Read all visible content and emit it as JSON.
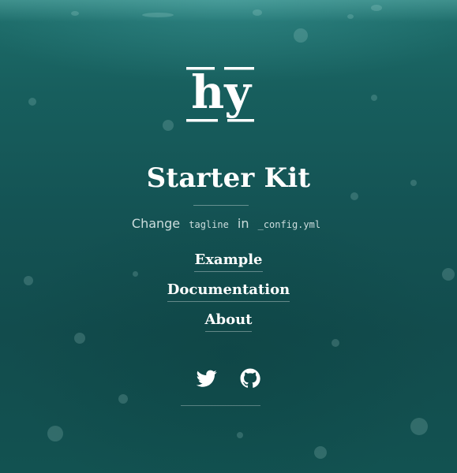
{
  "logo": {
    "alt": "hy"
  },
  "site": {
    "title": "Starter Kit",
    "tagline": {
      "prefix": "Change",
      "code1": "tagline",
      "middle": "in",
      "code2": "_config.yml"
    }
  },
  "nav": {
    "items": [
      {
        "label": "Example"
      },
      {
        "label": "Documentation"
      },
      {
        "label": "About"
      }
    ]
  },
  "social": {
    "items": [
      {
        "icon": "twitter-icon"
      },
      {
        "icon": "github-icon"
      }
    ]
  },
  "colors": {
    "background": "#145354",
    "text": "#ffffff"
  }
}
